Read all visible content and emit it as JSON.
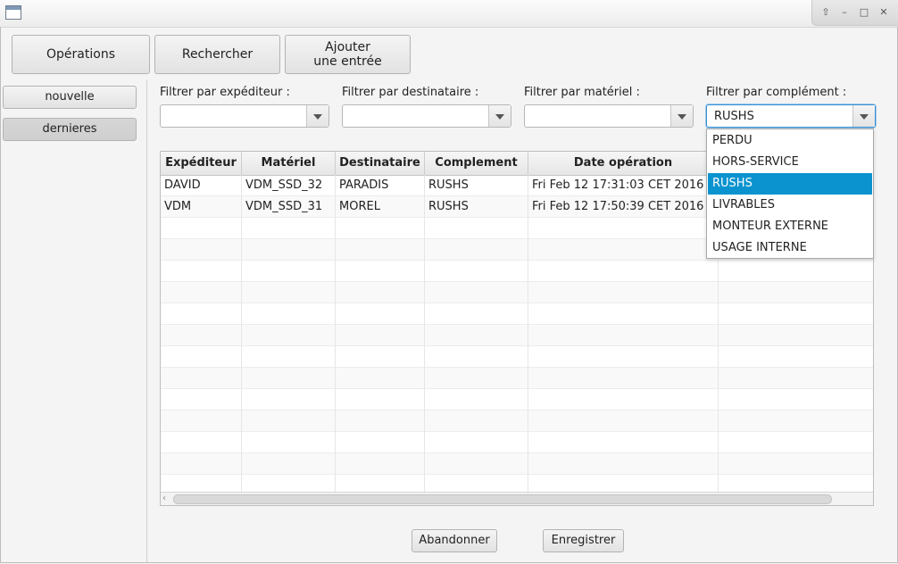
{
  "window": {
    "controls": [
      "restore-up",
      "minimize",
      "maximize",
      "close"
    ]
  },
  "toolbar": {
    "operations": "Opérations",
    "rechercher": "Rechercher",
    "ajouter_line1": "Ajouter",
    "ajouter_line2": "une entrée"
  },
  "sidebar": {
    "nouvelle": "nouvelle",
    "dernieres": "dernieres"
  },
  "filters": {
    "expediteur": {
      "label": "Filtrer par expéditeur :",
      "value": ""
    },
    "destinataire": {
      "label": "Filtrer par destinataire :",
      "value": ""
    },
    "materiel": {
      "label": "Filtrer par matériel :",
      "value": ""
    },
    "complement": {
      "label": "Filtrer par complément :",
      "value": "RUSHS"
    }
  },
  "table": {
    "columns": [
      "Expéditeur",
      "Matériel",
      "Destinataire",
      "Complement",
      "Date opération"
    ],
    "rows": [
      [
        "DAVID",
        "VDM_SSD_32",
        "PARADIS",
        "RUSHS",
        "Fri Feb 12 17:31:03 CET 2016"
      ],
      [
        "VDM",
        "VDM_SSD_31",
        "MOREL",
        "RUSHS",
        "Fri Feb 12 17:50:39 CET 2016"
      ]
    ]
  },
  "complement_dropdown": {
    "options": [
      "PERDU",
      "HORS-SERVICE",
      "RUSHS",
      "LIVRABLES",
      "MONTEUR EXTERNE",
      "USAGE INTERNE"
    ],
    "selected": "RUSHS"
  },
  "footer": {
    "abandonner": "Abandonner",
    "enregistrer": "Enregistrer"
  },
  "colors": {
    "selection": "#0b93d0",
    "focus": "#3a8fd0"
  }
}
